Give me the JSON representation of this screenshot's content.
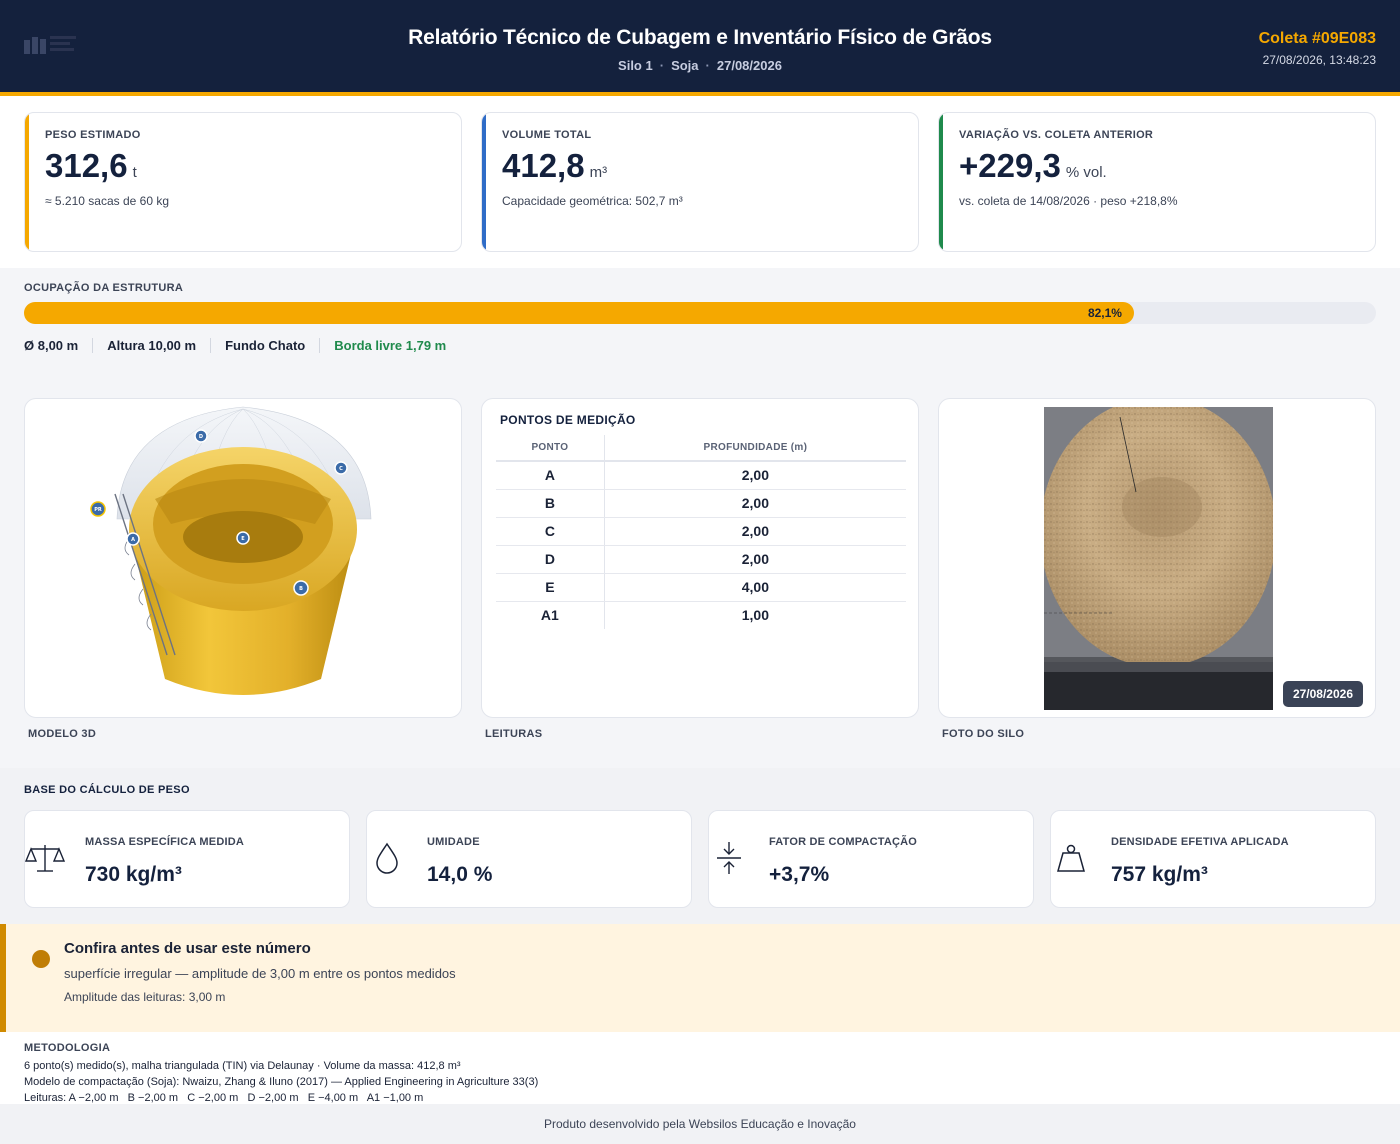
{
  "header": {
    "title": "Relatório Técnico de Cubagem e Inventário Físico de Grãos",
    "silo": "Silo 1",
    "grain": "Soja",
    "date": "27/08/2026",
    "coleta_label": "Coleta #09E083",
    "coleta_timestamp": "27/08/2026, 13:48:23"
  },
  "kpis": [
    {
      "label": "PESO ESTIMADO",
      "value": "312,6",
      "unit": "t",
      "sub": "≈ 5.210 sacas de 60 kg",
      "accent": "#f5a800"
    },
    {
      "label": "VOLUME TOTAL",
      "value": "412,8",
      "unit": "m³",
      "sub": "Capacidade geométrica: 502,7 m³",
      "accent": "#2f6cc7"
    },
    {
      "label": "VARIAÇÃO VS. COLETA ANTERIOR",
      "value": "+229,3",
      "unit": "% vol.",
      "sub": "vs. coleta de 14/08/2026 · peso +218,8%",
      "accent": "#1f8a4c"
    }
  ],
  "occupancy": {
    "label": "OCUPAÇÃO DA ESTRUTURA",
    "percent": 82.1,
    "percent_label": "82,1%",
    "specs": [
      "Ø 8,00 m",
      "Altura 10,00 m",
      "Fundo Chato"
    ],
    "free_border": "Borda livre 1,79 m"
  },
  "model3d": {
    "caption": "MODELO 3D",
    "markers": [
      "A",
      "B",
      "C",
      "D",
      "E",
      "PR"
    ]
  },
  "readings": {
    "caption": "LEITURAS",
    "title": "PONTOS DE MEDIÇÃO",
    "headers": [
      "PONTO",
      "PROFUNDIDADE (m)"
    ],
    "rows": [
      [
        "A",
        "2,00"
      ],
      [
        "B",
        "2,00"
      ],
      [
        "C",
        "2,00"
      ],
      [
        "D",
        "2,00"
      ],
      [
        "E",
        "4,00"
      ],
      [
        "A1",
        "1,00"
      ]
    ]
  },
  "photo": {
    "caption": "FOTO DO SILO",
    "badge": "27/08/2026"
  },
  "base_calc": {
    "label": "BASE DO CÁLCULO DE PESO",
    "cards": [
      {
        "label": "MASSA ESPECÍFICA MEDIDA",
        "value": "730 kg/m³",
        "icon": "scale-icon"
      },
      {
        "label": "UMIDADE",
        "value": "14,0 %",
        "icon": "droplet-icon"
      },
      {
        "label": "FATOR DE COMPACTAÇÃO",
        "value": "+3,7%",
        "icon": "compress-icon"
      },
      {
        "label": "DENSIDADE EFETIVA APLICADA",
        "value": "757 kg/m³",
        "icon": "weight-icon"
      }
    ]
  },
  "warning": {
    "title": "Confira antes de usar este número",
    "text": "superfície irregular — amplitude de 3,00 m entre os pontos medidos",
    "amplitude": "Amplitude das leituras: 3,00 m",
    "color": "#c07d05"
  },
  "methodology": {
    "label": "METODOLOGIA",
    "lines": [
      "6 ponto(s) medido(s), malha triangulada (TIN) via Delaunay · Volume da massa: 412,8 m³",
      "Modelo de compactação (Soja): Nwaizu, Zhang & Iluno (2017) — Applied Engineering in Agriculture 33(3)",
      "Leituras: A −2,00 m   B −2,00 m   C −2,00 m   D −2,00 m   E −4,00 m   A1 −1,00 m"
    ]
  },
  "footer": "Produto desenvolvido pela Websilos Educação e Inovação"
}
